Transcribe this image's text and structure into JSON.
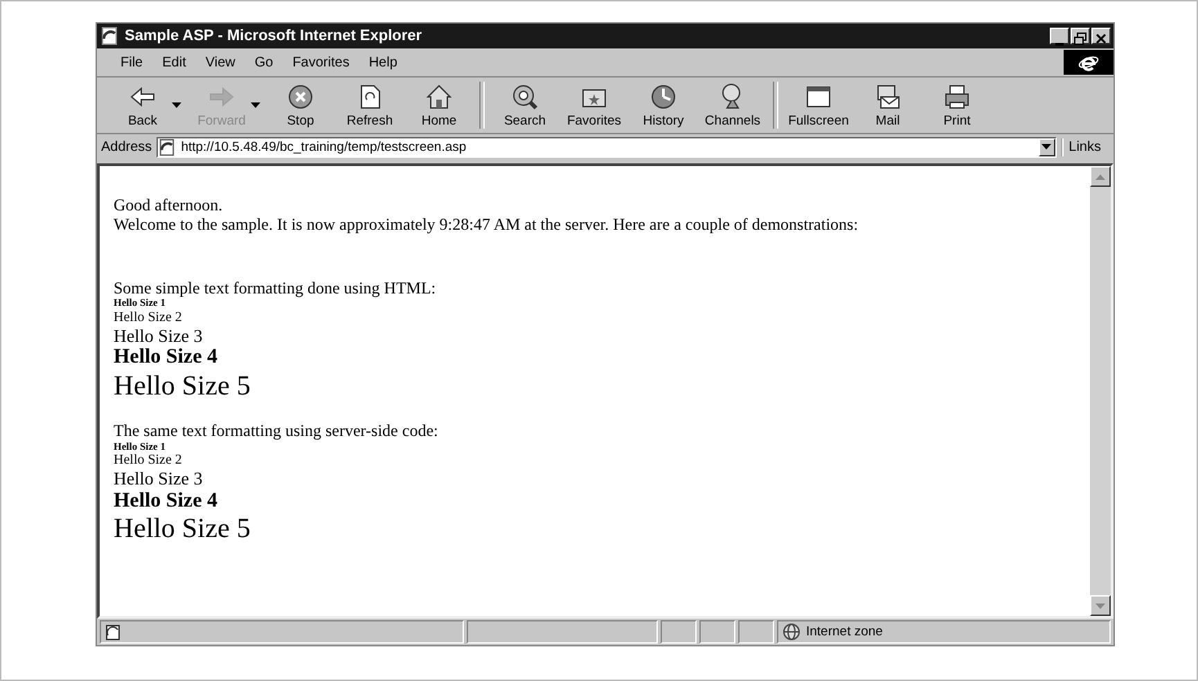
{
  "window": {
    "title": "Sample ASP - Microsoft Internet Explorer"
  },
  "menu": [
    {
      "label": "File"
    },
    {
      "label": "Edit"
    },
    {
      "label": "View"
    },
    {
      "label": "Go"
    },
    {
      "label": "Favorites"
    },
    {
      "label": "Help"
    }
  ],
  "toolbar": {
    "groups": [
      [
        {
          "kind": "back",
          "label": "Back",
          "disabled": false,
          "dropdown": true
        },
        {
          "kind": "forward",
          "label": "Forward",
          "disabled": true,
          "dropdown": true
        },
        {
          "kind": "stop",
          "label": "Stop",
          "disabled": false,
          "dropdown": false
        },
        {
          "kind": "refresh",
          "label": "Refresh",
          "disabled": false,
          "dropdown": false
        },
        {
          "kind": "home",
          "label": "Home",
          "disabled": false,
          "dropdown": false
        }
      ],
      [
        {
          "kind": "search",
          "label": "Search",
          "disabled": false,
          "dropdown": false
        },
        {
          "kind": "favorites",
          "label": "Favorites",
          "disabled": false,
          "dropdown": false
        },
        {
          "kind": "history",
          "label": "History",
          "disabled": false,
          "dropdown": false
        },
        {
          "kind": "channels",
          "label": "Channels",
          "disabled": false,
          "dropdown": false
        }
      ],
      [
        {
          "kind": "fullscreen",
          "label": "Fullscreen",
          "disabled": false,
          "dropdown": false
        },
        {
          "kind": "mail",
          "label": "Mail",
          "disabled": false,
          "dropdown": false
        },
        {
          "kind": "print",
          "label": "Print",
          "disabled": false,
          "dropdown": false
        }
      ]
    ]
  },
  "address_bar": {
    "label": "Address",
    "value": "http://10.5.48.49/bc_training/temp/testscreen.asp",
    "links": "Links"
  },
  "content": {
    "sections": [
      [
        {
          "kind": "plain",
          "text": "Good afternoon."
        },
        {
          "kind": "plain",
          "text": "Welcome to the sample. It is now approximately 9:28:47 AM at the server. Here are a couple of demonstrations:"
        }
      ],
      [
        {
          "kind": "plain",
          "text": "Some simple text formatting done using HTML:"
        },
        {
          "kind": "size1",
          "text": "Hello Size 1"
        },
        {
          "kind": "size2",
          "text": "Hello Size 2"
        },
        {
          "kind": "size3",
          "text": "Hello Size 3"
        },
        {
          "kind": "size4",
          "text": "Hello Size 4"
        },
        {
          "kind": "size5",
          "text": "Hello Size 5"
        }
      ],
      [
        {
          "kind": "plain",
          "text": "The same text formatting using server-side code:"
        },
        {
          "kind": "size1",
          "text": "Hello Size 1"
        },
        {
          "kind": "size2",
          "text": "Hello Size 2"
        },
        {
          "kind": "size3",
          "text": "Hello Size 3"
        },
        {
          "kind": "size4",
          "text": "Hello Size 4"
        },
        {
          "kind": "size5",
          "text": "Hello Size 5"
        }
      ]
    ]
  },
  "status_bar": {
    "zone": "Internet zone"
  }
}
